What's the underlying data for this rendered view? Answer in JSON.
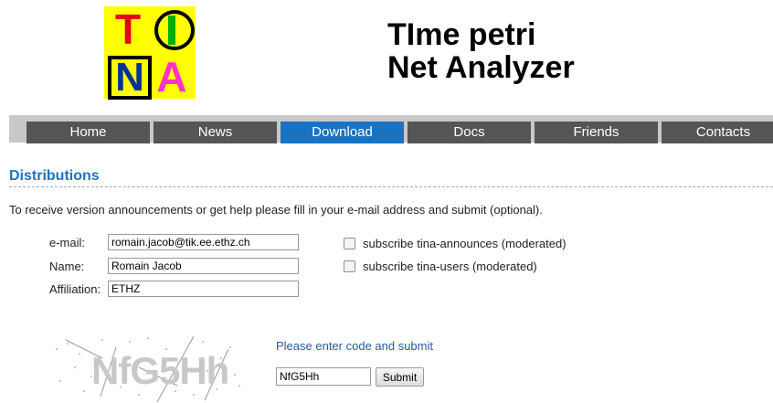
{
  "logo": {
    "letters": [
      "T",
      "I",
      "N",
      "A"
    ]
  },
  "header": {
    "title_line1": "TIme petri",
    "title_line2": "Net Analyzer"
  },
  "nav": {
    "tabs": [
      "Home",
      "News",
      "Download",
      "Docs",
      "Friends",
      "Contacts"
    ],
    "active": "Download"
  },
  "section": {
    "title": "Distributions",
    "intro": "To receive version announcements or get help please fill in your e-mail address and submit (optional)."
  },
  "form": {
    "email_label": "e-mail:",
    "email_value": "romain.jacob@tik.ee.ethz.ch",
    "name_label": "Name:",
    "name_value": "Romain Jacob",
    "affiliation_label": "Affiliation:",
    "affiliation_value": "ETHZ",
    "subscribe_announces": "subscribe tina-announces (moderated)",
    "subscribe_users": "subscribe tina-users (moderated)"
  },
  "captcha": {
    "image_text": "NfG5Hh",
    "prompt": "Please enter code and submit",
    "code_value": "NfG5Hh",
    "submit_label": "Submit"
  },
  "colors": {
    "accent": "#1f73c1",
    "nav_bg": "#555555",
    "nav_active": "#1a73c1",
    "logo_bg": "#ffff00"
  }
}
